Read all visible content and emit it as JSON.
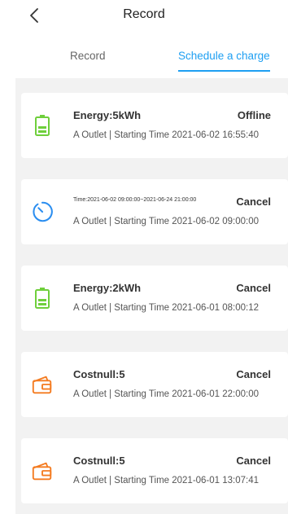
{
  "header": {
    "title": "Record"
  },
  "tabs": {
    "record_label": "Record",
    "schedule_label": "Schedule a charge"
  },
  "accent_color": "#1e9ff2",
  "records": [
    {
      "icon": "battery-icon",
      "main": "Energy:5kWh",
      "status": "Offline",
      "sub": "A Outlet | Starting Time 2021-06-02 16:55:40"
    },
    {
      "icon": "timer-icon",
      "main": "Time:2021-06-02 09:00:00~2021-06-24 21:00:00",
      "status": "Cancel",
      "sub": "A Outlet | Starting Time 2021-06-02 09:00:00"
    },
    {
      "icon": "battery-icon",
      "main": "Energy:2kWh",
      "status": "Cancel",
      "sub": "A Outlet | Starting Time 2021-06-01 08:00:12"
    },
    {
      "icon": "wallet-icon",
      "main": "Costnull:5",
      "status": "Cancel",
      "sub": "A Outlet | Starting Time 2021-06-01 22:00:00"
    },
    {
      "icon": "wallet-icon",
      "main": "Costnull:5",
      "status": "Cancel",
      "sub": "A Outlet | Starting Time 2021-06-01 13:07:41"
    }
  ]
}
